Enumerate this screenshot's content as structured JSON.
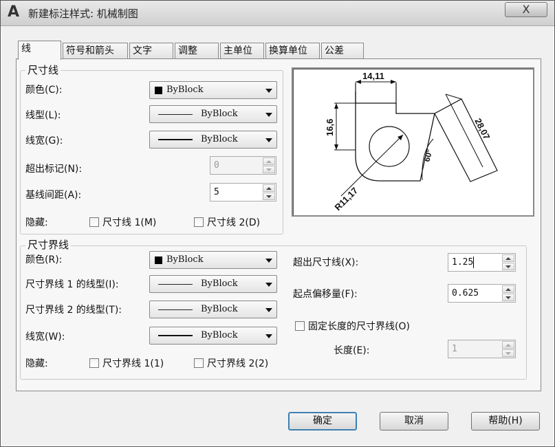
{
  "window": {
    "title": "新建标注样式: 机械制图",
    "close_label": "X"
  },
  "tabs": [
    "线",
    "符号和箭头",
    "文字",
    "调整",
    "主单位",
    "换算单位",
    "公差"
  ],
  "dim_lines": {
    "title": "尺寸线",
    "color_label": "颜色(C):",
    "color_value": "ByBlock",
    "linetype_label": "线型(L):",
    "linetype_value": "ByBlock",
    "lineweight_label": "线宽(G):",
    "lineweight_value": "ByBlock",
    "extend_ticks_label": "超出标记(N):",
    "extend_ticks_value": "0",
    "baseline_spacing_label": "基线间距(A):",
    "baseline_spacing_value": "5",
    "suppress_label": "隐藏:",
    "suppress_1_label": "尺寸线 1(M)",
    "suppress_2_label": "尺寸线 2(D)"
  },
  "ext_lines": {
    "title": "尺寸界线",
    "color_label": "颜色(R):",
    "color_value": "ByBlock",
    "linetype1_label": "尺寸界线 1 的线型(I):",
    "linetype1_value": "ByBlock",
    "linetype2_label": "尺寸界线 2 的线型(T):",
    "linetype2_value": "ByBlock",
    "lineweight_label": "线宽(W):",
    "lineweight_value": "ByBlock",
    "suppress_label": "隐藏:",
    "suppress_1_label": "尺寸界线 1(1)",
    "suppress_2_label": "尺寸界线 2(2)",
    "extend_beyond_label": "超出尺寸线(X):",
    "extend_beyond_value": "1.25",
    "offset_label": "起点偏移量(F):",
    "offset_value": "0.625",
    "fixed_length_label": "固定长度的尺寸界线(O)",
    "length_label": "长度(E):",
    "length_value": "1"
  },
  "preview": {
    "dim_top": "14,11",
    "dim_left": "16,6",
    "dim_right": "28,07",
    "dim_angle": "60°",
    "dim_radius": "R11,17"
  },
  "buttons": {
    "ok": "确定",
    "cancel": "取消",
    "help": "帮助(H)"
  },
  "colors": {
    "swatch": "#000000",
    "accent": "#3c7fb1"
  },
  "icons": [
    "app-icon",
    "close-icon",
    "dropdown-arrow-icon",
    "spin-up-icon",
    "spin-down-icon"
  ]
}
